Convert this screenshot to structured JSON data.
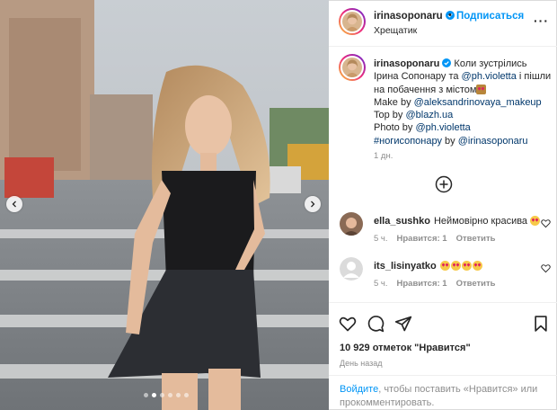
{
  "post": {
    "nav": {
      "prev_icon": "chevron-left-icon",
      "next_icon": "chevron-right-icon"
    },
    "carousel": {
      "slides": 6,
      "active": 1
    }
  },
  "header": {
    "username": "irinasoponaru",
    "separator": "•",
    "follow_label": "Подписаться",
    "location": "Хрещатик",
    "more_label": "···"
  },
  "caption": {
    "username": "irinasoponaru",
    "line1_a": "Коли зустрілись Ірина Сопонару та ",
    "mention_photographer": "@ph.violetta",
    "line1_b": " і пішли на побачення з містом",
    "make_prefix": "Make by ",
    "mention_makeup": "@aleksandrinovaya_makeup",
    "top_prefix": "Top by ",
    "mention_top": "@blazh.ua",
    "photo_prefix": "Photo by ",
    "mention_photo": "@ph.violetta",
    "hashtag": "#ногисопонару",
    "by_label": " by ",
    "mention_self": "@irinasoponaru",
    "time": "1 дн."
  },
  "comments": [
    {
      "username": "ella_sushko",
      "text": "Неймовірно красива",
      "emoji_count": 1,
      "time": "5 ч.",
      "likes": "Нравится: 1",
      "reply": "Ответить"
    },
    {
      "username": "its_lisinyatko",
      "text": "",
      "emoji_count": 4,
      "time": "5 ч.",
      "likes": "Нравится: 1",
      "reply": "Ответить"
    }
  ],
  "actions": {
    "likes": "10 929 отметок \"Нравится\"",
    "ago": "День назад"
  },
  "login": {
    "login_link": "Войдите",
    "rest": ", чтобы поставить «Нравится» или прокомментировать."
  },
  "colors": {
    "accent": "#0095f6",
    "text": "#262626",
    "muted": "#8e8e8e",
    "link": "#00376b"
  }
}
